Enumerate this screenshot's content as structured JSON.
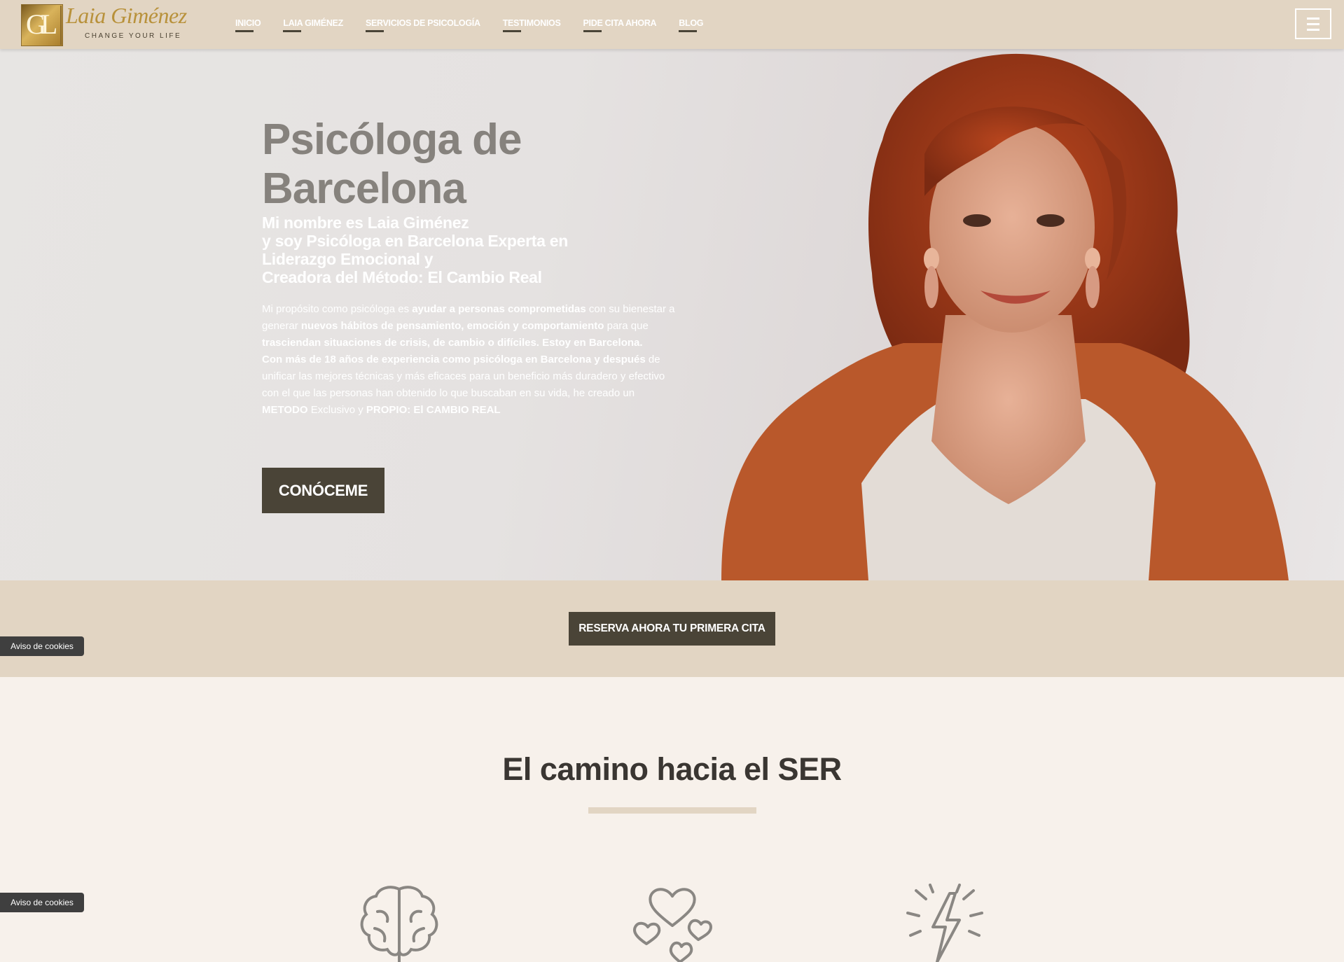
{
  "header": {
    "logo": {
      "monogram": "GL",
      "name": "Laia Giménez",
      "tagline": "CHANGE YOUR LIFE"
    },
    "nav": [
      {
        "label": "INICIO"
      },
      {
        "label": "LAIA GIMÉNEZ"
      },
      {
        "label": "SERVICIOS DE PSICOLOGÍA"
      },
      {
        "label": "TESTIMONIOS"
      },
      {
        "label": "PIDE CITA AHORA"
      },
      {
        "label": "BLOG"
      }
    ],
    "menu_icon": "hamburger-icon"
  },
  "hero": {
    "title": "Psicóloga de Barcelona",
    "subtitle_lines": [
      "Mi nombre es Laia Giménez",
      "y soy Psicóloga en Barcelona Experta en",
      "Liderazgo Emocional y",
      "Creadora del Método: El Cambio Real"
    ],
    "body": {
      "p1": {
        "t1": "Mi propósito como psicóloga es ",
        "b1": "ayudar a personas comprometidas",
        "t2": " con su bienestar a generar ",
        "b2": "nuevos hábitos de pensamiento, emoción y comportamiento",
        "t3": " para que ",
        "b3": "trasciendan situaciones de crisis, de cambio o difíciles. Estoy en Barcelona."
      },
      "p2": {
        "b1": "Con más de 18 años de experiencia como psicóloga en Barcelona y después",
        "t1": " de unificar las mejores técnicas y más eficaces para un beneficio más duradero y efectivo con el que las personas han obtenido lo que buscaban en su vida, he creado un ",
        "b2": "METODO",
        "t2": " Exclusivo y ",
        "b3": "PROPIO: El CAMBIO REAL"
      }
    },
    "cta_label": "CONÓCEME"
  },
  "booking": {
    "cta_label": "RESERVA AHORA TU PRIMERA CITA"
  },
  "section": {
    "title": "El camino hacia el SER",
    "icons": [
      "brain-icon",
      "hearts-icon",
      "lightning-icon"
    ]
  },
  "cookies": {
    "label": "Aviso de cookies"
  },
  "colors": {
    "header_bg": "#e2d5c3",
    "button_dark": "#4a4437",
    "page_bg": "#f7f1eb",
    "hero_title": "#86827d",
    "logo_gold": "#b8913a"
  }
}
